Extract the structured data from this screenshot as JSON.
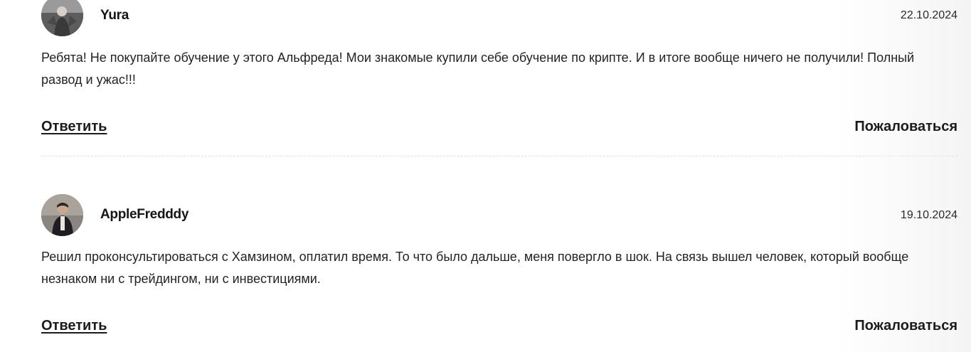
{
  "comments": [
    {
      "author": "Yura",
      "date": "22.10.2024",
      "text": "Ребята! Не покупайте обучение у этого Альфреда! Мои знакомые купили себе обучение по крипте. И в итоге вообще ничего не получили! Полный развод и ужас!!!",
      "reply_label": "Ответить",
      "report_label": "Пожаловаться"
    },
    {
      "author": "AppleFredddy",
      "date": "19.10.2024",
      "text": "Решил проконсультироваться с Хамзином, оплатил время. То что было дальше, меня повергло в шок. На связь вышел человек, который вообще незнаком ни с трейдингом, ни с инвестициями.",
      "reply_label": "Ответить",
      "report_label": "Пожаловаться"
    }
  ]
}
